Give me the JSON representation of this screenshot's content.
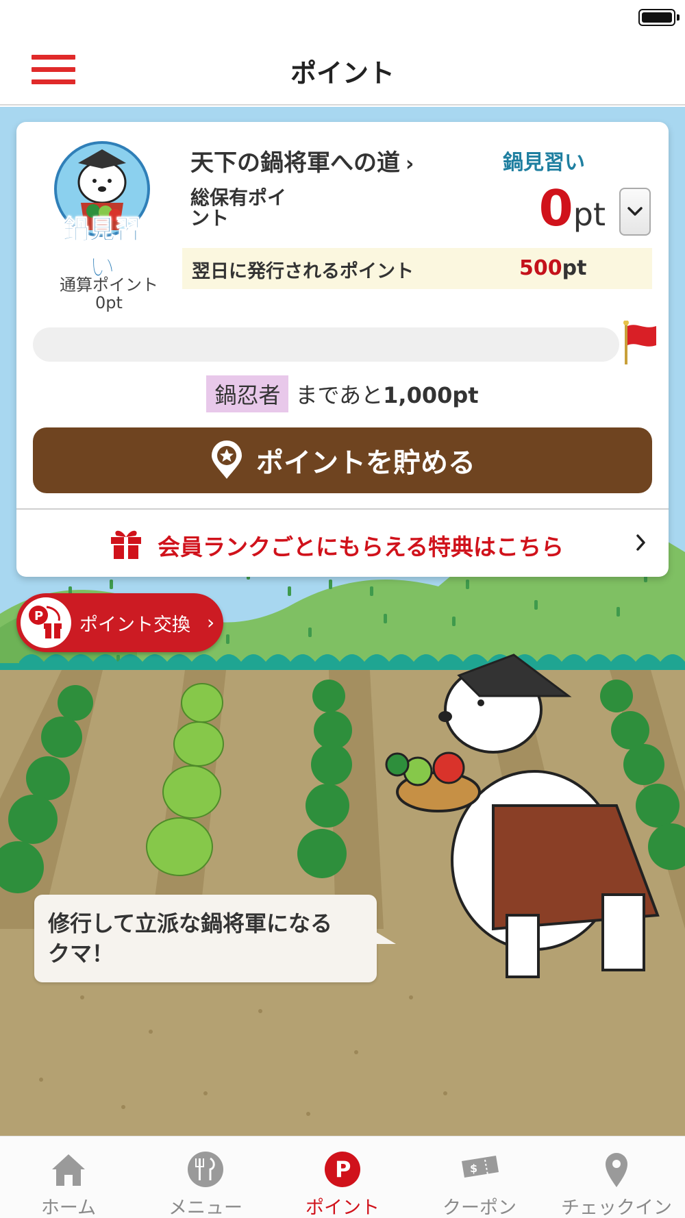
{
  "header": {
    "title": "ポイント"
  },
  "rank_card": {
    "badge_text": "鍋見習い",
    "cumulative_label": "通算ポイント",
    "cumulative_value": "0pt",
    "road_title": "天下の鍋将軍への道",
    "road_chevron": "›",
    "current_rank": "鍋見習い",
    "total_label": "総保有ポイント",
    "total_value": "0",
    "total_unit": "pt",
    "next_day_label": "翌日に発行されるポイント",
    "next_day_value": "500",
    "next_day_unit": "pt",
    "progress_fraction": 0,
    "next_rank_name": "鍋忍者",
    "next_rank_middle": "まであと",
    "next_rank_remaining": "1,000pt",
    "save_button_label": "ポイントを貯める",
    "benefit_link_label": "会員ランクごとにもらえる特典はこちら"
  },
  "exchange": {
    "label": "ポイント交換",
    "chevron": "›"
  },
  "speech_bubble": {
    "text": "修行して立派な鍋将軍になるクマ！"
  },
  "tabbar": {
    "items": [
      {
        "label": "ホーム",
        "icon": "home-icon",
        "active": false
      },
      {
        "label": "メニュー",
        "icon": "menu-cutlery-icon",
        "active": false
      },
      {
        "label": "ポイント",
        "icon": "point-p-icon",
        "active": true
      },
      {
        "label": "クーポン",
        "icon": "coupon-ticket-icon",
        "active": false
      },
      {
        "label": "チェックイン",
        "icon": "location-pin-icon",
        "active": false
      }
    ]
  },
  "colors": {
    "brand_red": "#d0121b",
    "save_button_brown": "#6f4420",
    "rank_blue": "#1f7fa0",
    "sky": "#a8d7f0",
    "field": "#b4a172"
  }
}
